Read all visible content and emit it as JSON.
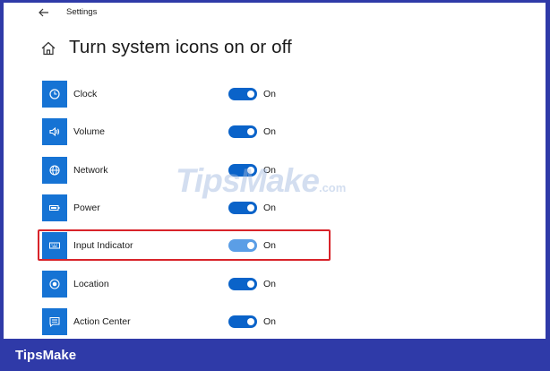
{
  "window": {
    "title": "Settings",
    "page_title": "Turn system icons on or off"
  },
  "settings": [
    {
      "label": "Clock",
      "state": "On",
      "icon": "clock-icon"
    },
    {
      "label": "Volume",
      "state": "On",
      "icon": "volume-icon"
    },
    {
      "label": "Network",
      "state": "On",
      "icon": "network-globe-icon"
    },
    {
      "label": "Power",
      "state": "On",
      "icon": "battery-icon"
    },
    {
      "label": "Input Indicator",
      "state": "On",
      "icon": "keyboard-icon",
      "highlighted": true
    },
    {
      "label": "Location",
      "state": "On",
      "icon": "location-icon"
    },
    {
      "label": "Action Center",
      "state": "On",
      "icon": "action-center-icon"
    }
  ],
  "watermark": {
    "main": "TipsMake",
    "suffix": ".com"
  },
  "footer": {
    "brand": "TipsMake"
  },
  "colors": {
    "frame": "#2f3aa8",
    "tile": "#1673d4",
    "toggle_on": "#0a63c9",
    "highlight": "#d8232a"
  }
}
